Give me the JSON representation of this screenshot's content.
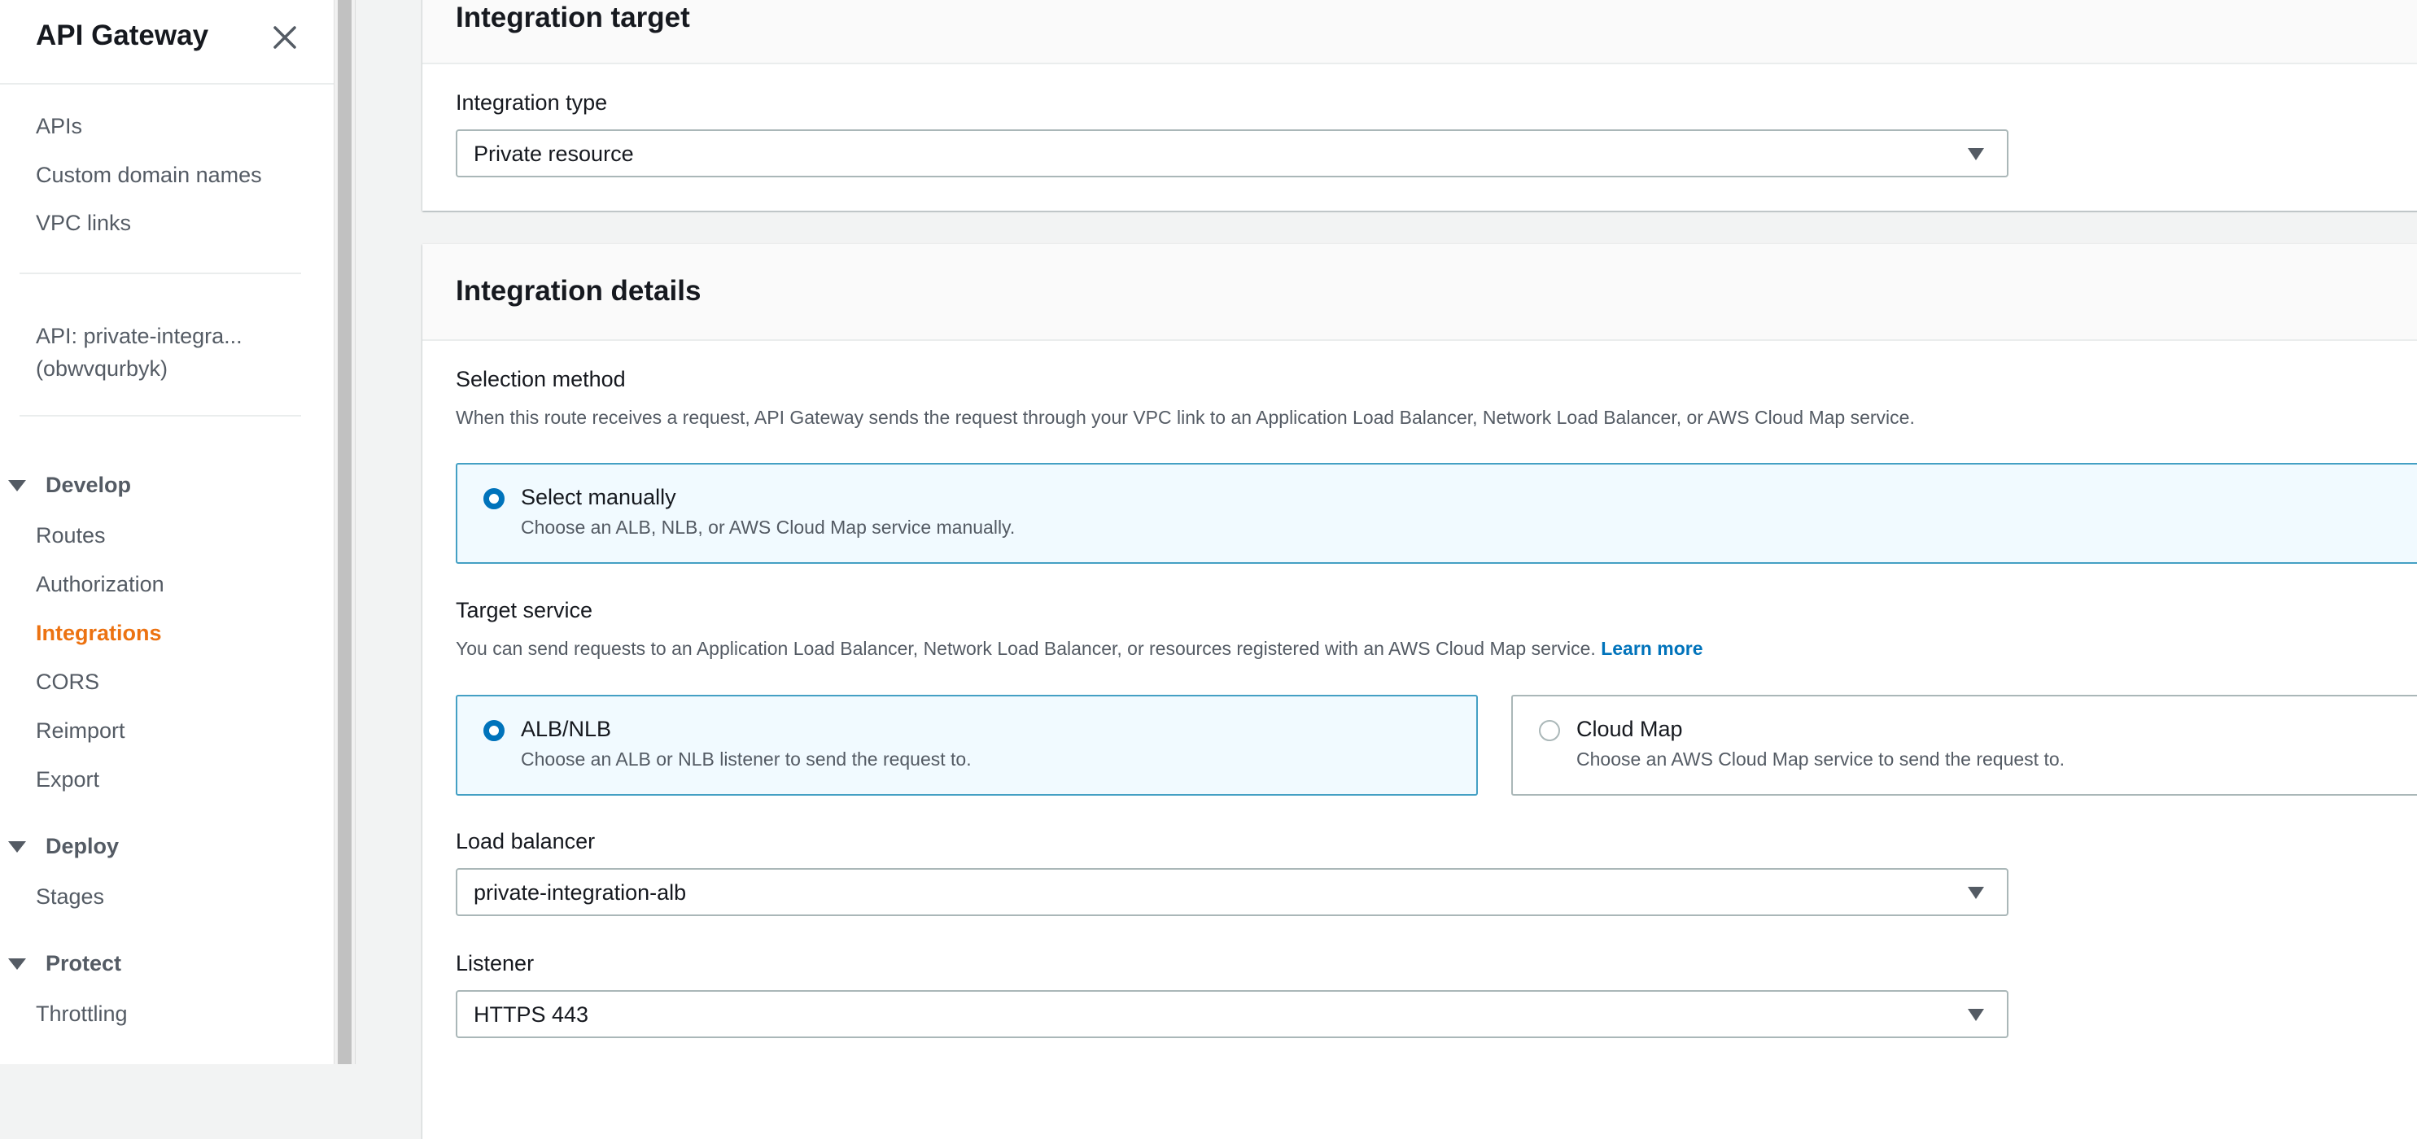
{
  "sidebar": {
    "title": "API Gateway",
    "close_icon": "close-icon",
    "top_links": [
      {
        "label": "APIs"
      },
      {
        "label": "Custom domain names"
      },
      {
        "label": "VPC links"
      }
    ],
    "api_name_line1": "API: private-integra...",
    "api_name_line2": "(obwvqurbyk)",
    "sections": [
      {
        "label": "Develop",
        "expanded": true,
        "items": [
          {
            "label": "Routes",
            "active": false
          },
          {
            "label": "Authorization",
            "active": false
          },
          {
            "label": "Integrations",
            "active": true
          },
          {
            "label": "CORS",
            "active": false
          },
          {
            "label": "Reimport",
            "active": false
          },
          {
            "label": "Export",
            "active": false
          }
        ]
      },
      {
        "label": "Deploy",
        "expanded": true,
        "items": [
          {
            "label": "Stages",
            "active": false
          }
        ]
      },
      {
        "label": "Protect",
        "expanded": true,
        "items": [
          {
            "label": "Throttling",
            "active": false
          }
        ]
      }
    ]
  },
  "colors": {
    "accent_active": "#ec7211",
    "link": "#0073bb",
    "selected_tile_border": "#44a0c4",
    "selected_tile_bg": "#f1faff",
    "page_bg": "#f2f3f3"
  },
  "integration_target": {
    "title": "Integration target",
    "integration_type_label": "Integration type",
    "integration_type_value": "Private resource"
  },
  "integration_details": {
    "title": "Integration details",
    "selection_method": {
      "label": "Selection method",
      "description": "When this route receives a request, API Gateway sends the request through your VPC link to an Application Load Balancer, Network Load Balancer, or AWS Cloud Map service.",
      "options": [
        {
          "title": "Select manually",
          "description": "Choose an ALB, NLB, or AWS Cloud Map service manually.",
          "selected": true
        }
      ]
    },
    "target_service": {
      "label": "Target service",
      "description": "You can send requests to an Application Load Balancer, Network Load Balancer, or resources registered with an AWS Cloud Map service.",
      "learn_more": "Learn more",
      "options": [
        {
          "title": "ALB/NLB",
          "description": "Choose an ALB or NLB listener to send the request to.",
          "selected": true
        },
        {
          "title": "Cloud Map",
          "description": "Choose an AWS Cloud Map service to send the request to.",
          "selected": false
        }
      ]
    },
    "load_balancer": {
      "label": "Load balancer",
      "value": "private-integration-alb"
    },
    "listener": {
      "label": "Listener",
      "value": "HTTPS 443"
    }
  }
}
